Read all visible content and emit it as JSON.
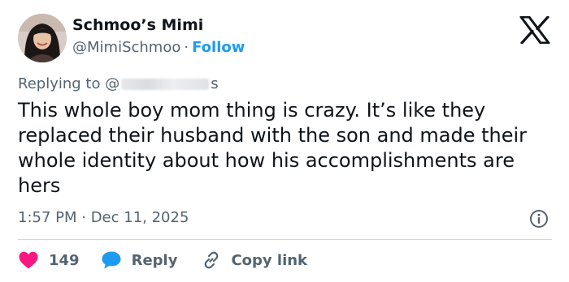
{
  "author": {
    "name": "Schmoo’s Mimi",
    "handle": "@MimiSchmoo",
    "separator": "·",
    "follow_label": "Follow"
  },
  "reply_context": {
    "prefix": "Replying to @",
    "suffix": "s"
  },
  "tweet": {
    "text": "This whole boy mom thing is crazy. It’s like they replaced their husband with the son and made their whole identity about how his accomplishments are hers",
    "timestamp": "1:57 PM · Dec 11, 2025"
  },
  "actions": {
    "likes": "149",
    "reply_label": "Reply",
    "copy_label": "Copy link"
  },
  "colors": {
    "accent": "#1d9bf0",
    "like": "#f91880",
    "muted": "#536471",
    "text": "#0f1419"
  },
  "icons": {
    "logo": "x-logo-icon",
    "info": "info-icon",
    "like": "heart-icon",
    "reply": "speech-bubble-icon",
    "copy": "link-icon"
  }
}
